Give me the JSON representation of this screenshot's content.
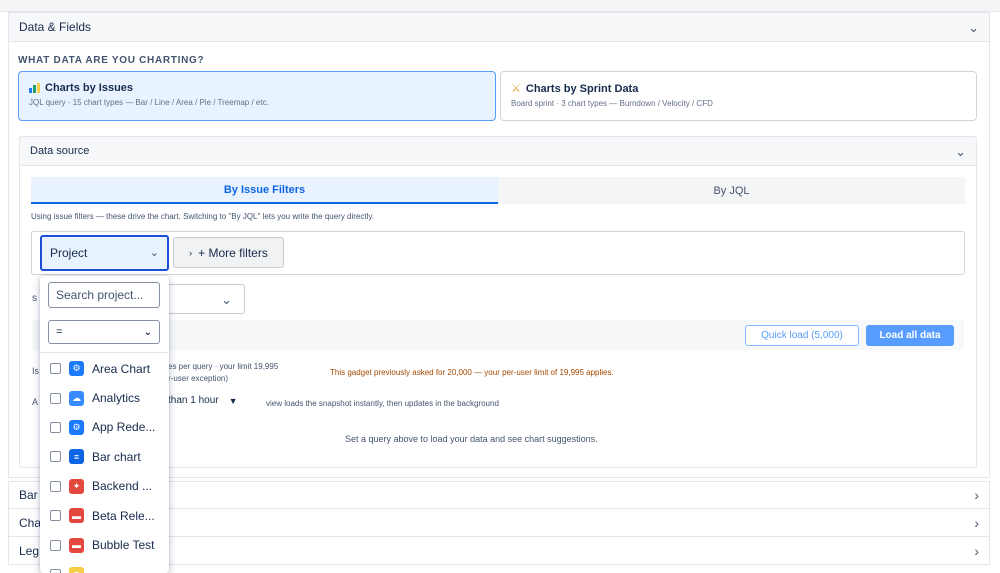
{
  "sections": {
    "data_fields": "Data & Fields",
    "bar": "Bar",
    "chart": "Cha",
    "legend": "Leg"
  },
  "question": "WHAT DATA ARE YOU CHARTING?",
  "cards": [
    {
      "title": "Charts by Issues",
      "subtitle": "JQL query · 15 chart types — Bar / Line / Area / Pie / Treemap / etc.",
      "icon": "bar-chart-icon"
    },
    {
      "title": "Charts by Sprint Data",
      "subtitle": "Board sprint · 3 chart types — Burndown / Velocity / CFD",
      "icon": "runner-icon"
    }
  ],
  "data_source": {
    "title": "Data source",
    "tabs": [
      "By Issue Filters",
      "By JQL"
    ],
    "hint": "Using issue filters — these drive the chart. Switching to \"By JQL\" lets you write the query directly.",
    "project_label": "Project",
    "more_filters": "+ More filters",
    "s_fragment": "s",
    "quick_load": "Quick load (5,000)",
    "load_all": "Load all data",
    "is_fragment": "Is",
    "limit_fragment_1": "es per query · your limit 19,995",
    "limit_fragment_2": "r-user exception)",
    "warning": "This gadget previously asked for 20,000 — your per-user limit of 19,995 applies.",
    "a_fragment": "A",
    "cache_value": "than 1 hour",
    "cache_note": "view loads the snapshot instantly, then updates in the background",
    "empty_message": "Set a query above to load your data and see chart suggestions."
  },
  "dropdown": {
    "search_placeholder": "Search project...",
    "operator": "=",
    "options": [
      {
        "label": "Area Chart",
        "icon": "gear-app-icon",
        "color": "#1d7afc"
      },
      {
        "label": "Analytics",
        "icon": "cloud-app-icon",
        "color": "#388bff"
      },
      {
        "label": "App Rede...",
        "icon": "gear-app-icon",
        "color": "#1d7afc"
      },
      {
        "label": "Bar chart",
        "icon": "doc-app-icon",
        "color": "#0c66e4"
      },
      {
        "label": "Backend ...",
        "icon": "puzzle-app-icon",
        "color": "#e2483d"
      },
      {
        "label": "Beta Rele...",
        "icon": "board-app-icon",
        "color": "#e2483d"
      },
      {
        "label": "Bubble Test",
        "icon": "board-app-icon",
        "color": "#e2483d"
      },
      {
        "label": "",
        "icon": "folder-app-icon",
        "color": "#f5cd47"
      }
    ]
  },
  "colors": {
    "accent": "#0c66e4",
    "selected_bg": "#e9f2ff",
    "warning": "#a54800"
  }
}
